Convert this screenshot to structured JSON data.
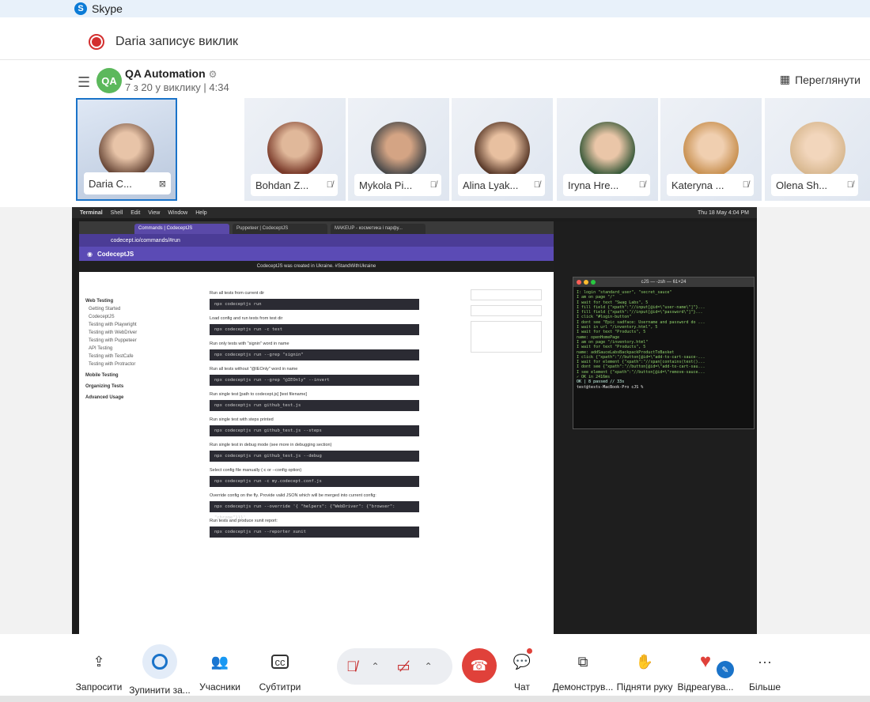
{
  "app": {
    "title": "Skype",
    "logo_icon": "skype-logo-icon"
  },
  "recording": {
    "text": "Daria записує виклик"
  },
  "call": {
    "group_initials": "QA",
    "group_name": "QA Automation",
    "status": "7 з 20 у виклику | 4:34",
    "view_button": "Переглянути"
  },
  "participants": [
    {
      "name": "Daria C...",
      "muted": false,
      "self": true
    },
    {
      "name": "Bohdan Z...",
      "muted": true
    },
    {
      "name": "Mykola Pi...",
      "muted": true
    },
    {
      "name": "Alina Lyak...",
      "muted": true
    },
    {
      "name": "Iryna Hre...",
      "muted": true
    },
    {
      "name": "Kateryna ...",
      "muted": true
    },
    {
      "name": "Olena Sh...",
      "muted": true
    }
  ],
  "shared_screen": {
    "menubar": [
      "Terminal",
      "Shell",
      "Edit",
      "View",
      "Window",
      "Help"
    ],
    "clock": "Thu 18 May 4:04 PM",
    "tabs": [
      "Commands | CodeceptJS",
      "Puppeteer | CodeceptJS",
      "MAKEUP - косметика і парфу..."
    ],
    "url": "codecept.io/commands/#run",
    "site_name": "CodeceptJS",
    "banner": "CodeceptJS was created in Ukraine. #StandWithUkraine",
    "sidebar": [
      "Web Testing",
      "Getting Started",
      "CodeceptJS",
      "Testing with Playwright",
      "Testing with WebDriver",
      "Testing with Puppeteer",
      "API Testing",
      "Testing with TestCafe",
      "Testing with Protractor",
      "Mobile Testing",
      "Organizing Tests",
      "Advanced Usage"
    ],
    "docs": [
      {
        "text": "Run all tests from current dir",
        "code": "npx codeceptjs run"
      },
      {
        "text": "Load config and run tests from test dir",
        "code": "npx codeceptjs run -c test"
      },
      {
        "text": "Run only tests with \"signin\" word in name",
        "code": "npx codeceptjs run --grep \"signin\""
      },
      {
        "text": "Run all tests without \"@IEOnly\" word in name",
        "code": "npx codeceptjs run --grep \"@IEOnly\" --invert"
      },
      {
        "text": "Run single test [path to codecept.js] [test filename]",
        "code": "npx codeceptjs run github_test.js"
      },
      {
        "text": "Run single test with steps printed",
        "code": "npx codeceptjs run github_test.js --steps"
      },
      {
        "text": "Run single test in debug mode (see more in debugging section)",
        "code": "npx codeceptjs run github_test.js --debug"
      },
      {
        "text": "Select config file manually (-c or --config option)",
        "code": "npx codeceptjs run -c my.codecept.conf.js"
      },
      {
        "text": "Override config on the fly. Provide valid JSON which will be merged into current config:",
        "code": "npx codeceptjs run --override '{ \"helpers\": {\"WebDriver\": {\"browser\": \"chrome\"}}}'"
      },
      {
        "text": "Run tests and produce xunit report:",
        "code": "npx codeceptjs run --reporter xunit"
      }
    ],
    "terminal_title": "cJS — -zsh — 61×24",
    "terminal_lines": [
      "I: login \"standard_user\", \"secret_sauce\"",
      "  I am on page \"/\"",
      "  I wait for text \"Swag Labs\", 5",
      "  I fill field {\"xpath\":\"//input[@id=\\\"user-name\\\"]\"}...",
      "  I fill field {\"xpath\":\"//input[@id=\\\"password\\\"]\"}...",
      "  I click \"#login-button\"",
      "  I dont see \"Epic sadface: Username and password do ...",
      "  I wait in url \"/inventory.html\", 5",
      "  I wait for text \"Products\", 5",
      "name: openHomePage",
      "  I am on page \"/inventory.html\"",
      "  I wait for text \"Products\", 5",
      "name: addSauceLabsBackpackProductToBasket",
      "  I click {\"xpath\":\"//button[@id=\\\"add-to-cart-sauce-...",
      "  I wait for element {\"xpath\":\"//span[contains(text()...",
      "  I dont see {\"xpath\":\"//button[@id=\\\"add-to-cart-sau...",
      "  I see element {\"xpath\":\"//button[@id=\\\"remove-sauce...",
      "✓ OK in 2416ms",
      "",
      "OK | 8 passed // 33s",
      "test@tests-MacBook-Pro cJS %"
    ]
  },
  "toolbar": {
    "invite": "Запросити",
    "stop": "Зупинити за...",
    "participants": "Учасники",
    "subtitles": "Субтитри",
    "chat": "Чат",
    "share": "Демонструв...",
    "raise_hand": "Підняти руку",
    "react": "Відреагува...",
    "more": "Більше"
  },
  "colors": {
    "accent": "#1a73c9",
    "end_call": "#e0413a",
    "record": "#d32f2f"
  }
}
